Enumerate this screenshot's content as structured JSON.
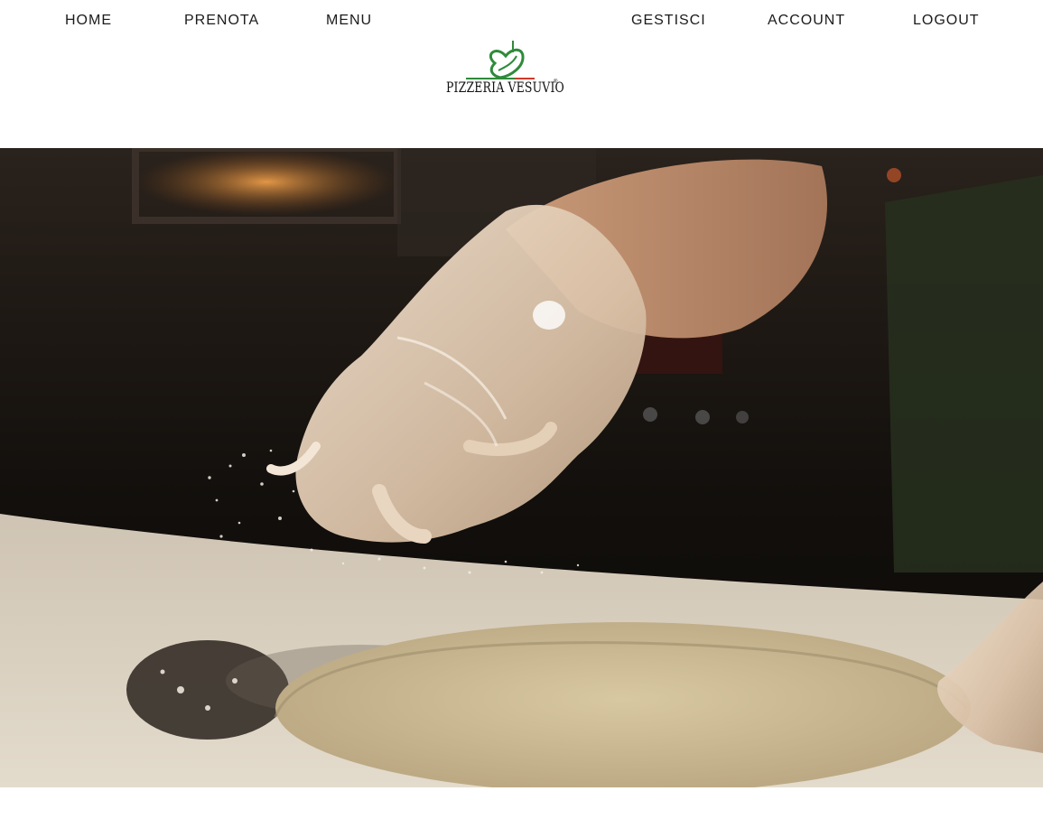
{
  "nav": {
    "left": [
      {
        "label": "HOME"
      },
      {
        "label": "PRENOTA"
      },
      {
        "label": "MENU"
      }
    ],
    "right": [
      {
        "label": "GESTISCI"
      },
      {
        "label": "ACCOUNT"
      },
      {
        "label": "LOGOUT"
      }
    ]
  },
  "logo": {
    "text": "PIZZERIA VESUVIO",
    "mark": "®",
    "icon": "heart-leaf-icon",
    "colors": {
      "green": "#2e8b3a",
      "red": "#d03a2b"
    }
  },
  "hero": {
    "image": "pizza-dough-flour-image"
  }
}
